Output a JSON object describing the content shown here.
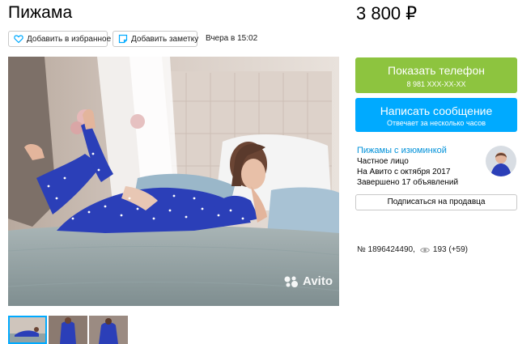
{
  "listing": {
    "title": "Пижама",
    "price": "3 800 ₽",
    "favorite_label": "Добавить в избранное",
    "note_label": "Добавить заметку",
    "date": "Вчера в 15:02",
    "id_text": "№ 1896424490,",
    "views_text": "193 (+59)"
  },
  "photo": {
    "watermark": "Avito",
    "thumbnail_count": 3
  },
  "contact": {
    "phone_label": "Показать телефон",
    "phone_masked": "8 981 XXX-XX-XX",
    "message_label": "Написать сообщение",
    "message_sub": "Отвечает за несколько часов"
  },
  "seller": {
    "name": "Пижамы с изюминкой",
    "type": "Частное лицо",
    "since": "На Авито с октября 2017",
    "completed": "Завершено 17 объявлений",
    "subscribe_label": "Подписаться на продавца"
  },
  "colors": {
    "phone_button": "#8dc43f",
    "message_button": "#00aaff",
    "link": "#0091d9",
    "pajama_blue": "#2b3fb8"
  },
  "icons": [
    "heart-icon",
    "note-icon",
    "eye-icon",
    "avito-logo"
  ]
}
